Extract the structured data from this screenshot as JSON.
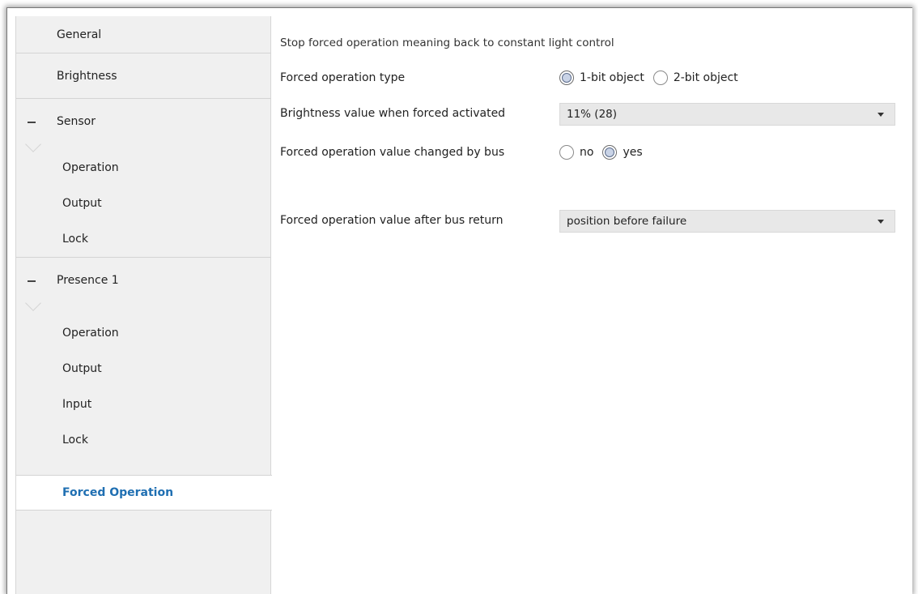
{
  "sidebar": {
    "general": "General",
    "brightness": "Brightness",
    "sensor": {
      "label": "Sensor",
      "items": [
        "Operation",
        "Output",
        "Lock"
      ]
    },
    "presence": {
      "label": "Presence 1",
      "items": [
        "Operation",
        "Output",
        "Input",
        "Lock",
        "Forced Operation"
      ],
      "active_item": "Forced Operation"
    }
  },
  "main": {
    "section_title": "Stop forced operation meaning back to constant light control",
    "forced_type": {
      "label": "Forced operation type",
      "options": [
        "1-bit object",
        "2-bit object"
      ],
      "selected": "1-bit object"
    },
    "brightness_value": {
      "label": "Brightness value when forced activated",
      "value": "11% (28)"
    },
    "changed_by_bus": {
      "label": "Forced operation value changed by bus",
      "options": [
        "no",
        "yes"
      ],
      "selected": "yes"
    },
    "after_bus_return": {
      "label": "Forced operation value after bus return",
      "value": "position before failure"
    }
  },
  "colors": {
    "active_text": "#1f6fb2",
    "sidebar_bg": "#f0f0f0",
    "select_bg": "#e8e8e8"
  }
}
